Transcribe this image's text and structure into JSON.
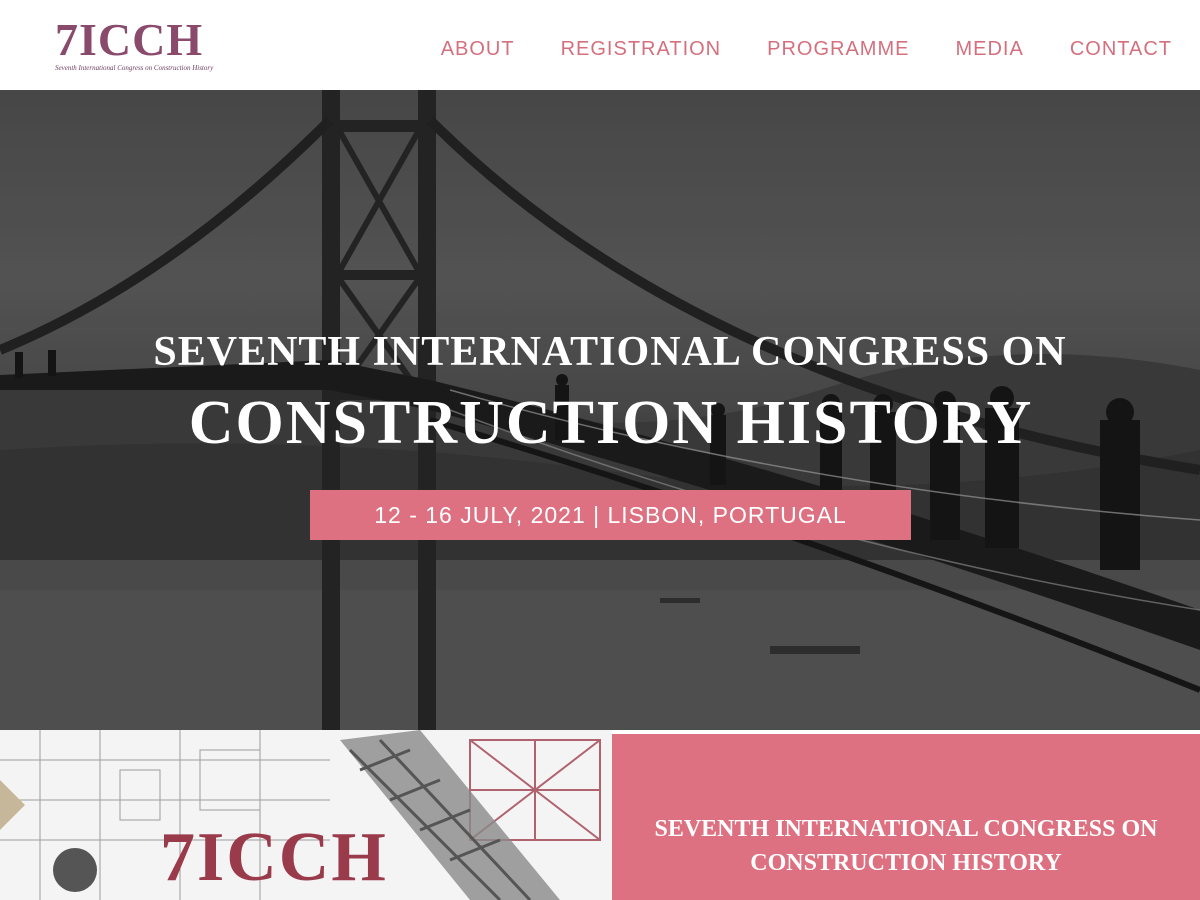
{
  "header": {
    "logo_text": "7ICCH",
    "logo_subtitle": "Seventh International Congress on Construction History",
    "nav": [
      {
        "label": "ABOUT"
      },
      {
        "label": "REGISTRATION"
      },
      {
        "label": "PROGRAMME"
      },
      {
        "label": "MEDIA"
      },
      {
        "label": "CONTACT"
      }
    ]
  },
  "hero": {
    "title_line1": "SEVENTH INTERNATIONAL CONGRESS ON",
    "title_line2": "CONSTRUCTION HISTORY",
    "date_location": "12 - 16 JULY, 2021 | LISBON, PORTUGAL"
  },
  "bottom": {
    "promo_logo": "7ICCH",
    "panel_text": "SEVENTH INTERNATIONAL CONGRESS ON CONSTRUCTION HISTORY"
  },
  "colors": {
    "accent_pink": "#dd7181",
    "nav_pink": "#d4707e",
    "logo_purple": "#8a4a6c"
  },
  "icons": [
    "bridge-photo",
    "construction-blueprint-image"
  ]
}
